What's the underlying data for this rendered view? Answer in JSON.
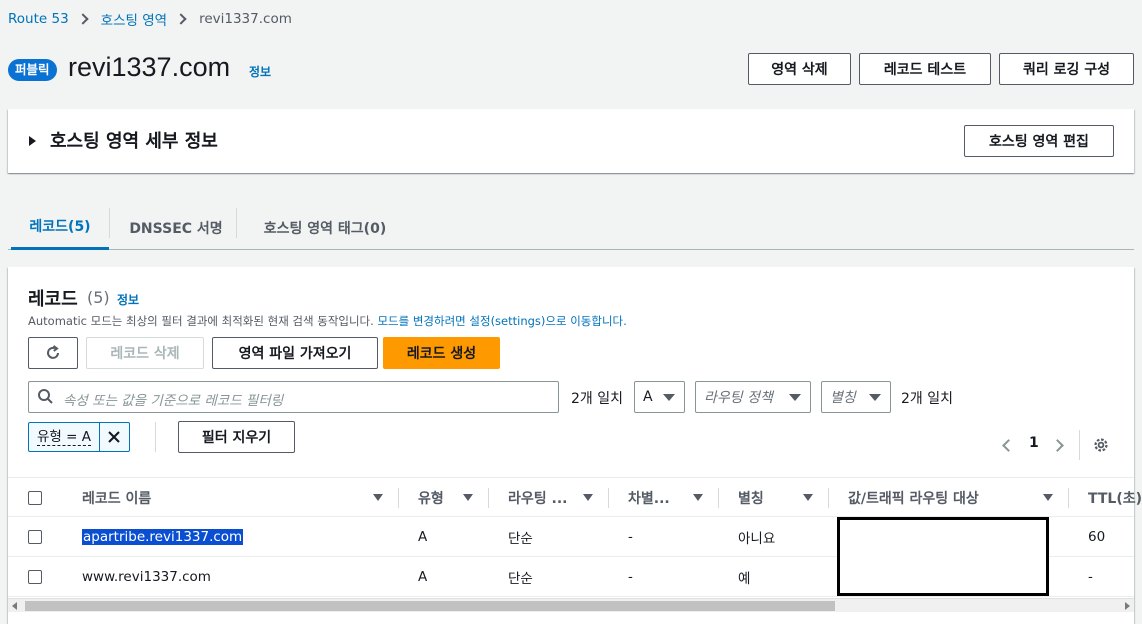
{
  "breadcrumb": {
    "items": [
      "Route 53",
      "호스팅 영역"
    ],
    "current": "revi1337.com"
  },
  "header": {
    "badge": "퍼블릭",
    "title": "revi1337.com",
    "info": "정보",
    "buttons": {
      "delete_zone": "영역 삭제",
      "test_record": "레코드 테스트",
      "query_logging": "쿼리 로깅 구성"
    }
  },
  "details": {
    "title": "호스팅 영역 세부 정보",
    "edit_button": "호스팅 영역 편집"
  },
  "tabs": [
    {
      "label": "레코드(5)",
      "active": true
    },
    {
      "label": "DNSSEC 서명",
      "active": false
    },
    {
      "label": "호스팅 영역 태그(0)",
      "active": false
    }
  ],
  "records": {
    "title": "레코드",
    "count": "(5)",
    "info": "정보",
    "desc_prefix": "Automatic 모드는 최상의 필터 결과에 최적화된 현재 검색 동작입니다.",
    "desc_link": "모드를 변경하려면 설정(settings)으로 이동합니다.",
    "buttons": {
      "delete": "레코드 삭제",
      "import": "영역 파일 가져오기",
      "create": "레코드 생성"
    },
    "search_placeholder": "속성 또는 값을 기준으로 레코드 필터링",
    "match_count_1": "2개 일치",
    "type_select": "A",
    "routing_select": "라우팅 정책",
    "alias_select": "별칭",
    "match_count_2": "2개 일치",
    "filter_token": "유형 = A",
    "clear_filters": "필터 지우기",
    "page": "1"
  },
  "table": {
    "columns": [
      "레코드 이름",
      "유형",
      "라우팅 ...",
      "차별...",
      "별칭",
      "값/트래픽 라우팅 대상",
      "TTL(초)"
    ],
    "rows": [
      {
        "name": "apartribe.revi1337.com",
        "type": "A",
        "routing": "단순",
        "diff": "-",
        "alias": "아니요",
        "value": "",
        "ttl": "60",
        "highlighted": true
      },
      {
        "name": "www.revi1337.com",
        "type": "A",
        "routing": "단순",
        "diff": "-",
        "alias": "예",
        "value": "",
        "ttl": "-",
        "highlighted": false
      }
    ]
  },
  "colors": {
    "accent": "#0073bb",
    "primary_button": "#ff9900",
    "badge": "#0972d3"
  }
}
